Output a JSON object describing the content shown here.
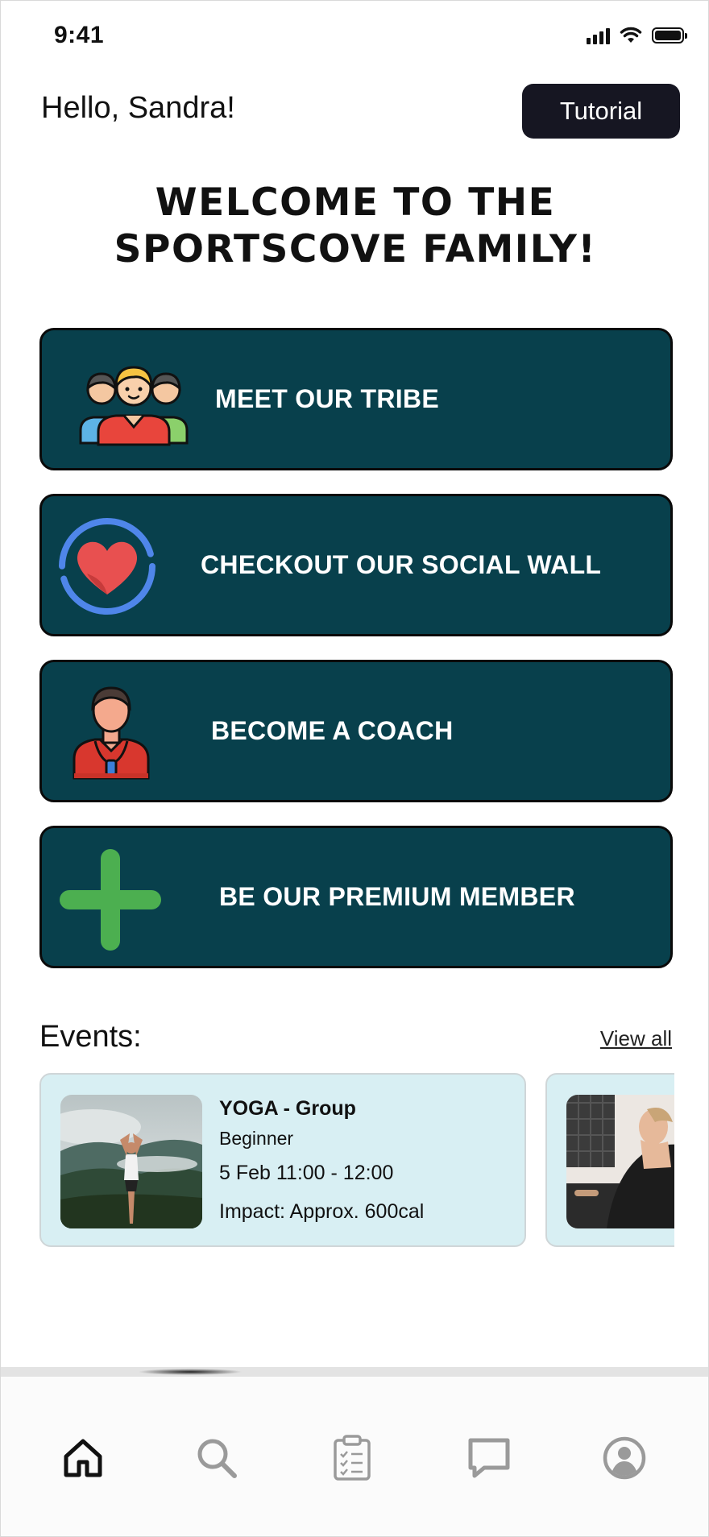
{
  "status": {
    "time": "9:41"
  },
  "header": {
    "greeting": "Hello, Sandra!",
    "tutorial_label": "Tutorial"
  },
  "welcome": {
    "line1": "WELCOME TO THE",
    "line2": "SPORTSCOVE FAMILY!"
  },
  "actions": [
    {
      "label": "MEET OUR TRIBE",
      "icon": "group-people-icon"
    },
    {
      "label": "CHECKOUT OUR SOCIAL WALL",
      "icon": "heart-ring-icon"
    },
    {
      "label": "BECOME A COACH",
      "icon": "coach-icon"
    },
    {
      "label": "BE OUR PREMIUM MEMBER",
      "icon": "plus-icon"
    }
  ],
  "events": {
    "title": "Events:",
    "view_all": "View all",
    "items": [
      {
        "title": "YOGA - Group",
        "level": "Beginner",
        "time": "5 Feb 11:00 - 12:00",
        "impact": "Impact: Approx. 600cal",
        "image": "yoga-mountain-photo"
      },
      {
        "image": "yoga-stretch-photo"
      }
    ]
  },
  "tabs": [
    {
      "name": "home",
      "icon": "home-icon",
      "active": true
    },
    {
      "name": "search",
      "icon": "search-icon",
      "active": false
    },
    {
      "name": "tasks",
      "icon": "clipboard-icon",
      "active": false
    },
    {
      "name": "chat",
      "icon": "chat-icon",
      "active": false
    },
    {
      "name": "profile",
      "icon": "profile-icon",
      "active": false
    }
  ],
  "colors": {
    "card_bg": "#08404c",
    "event_bg": "#d8eff3",
    "tutorial_bg": "#161622",
    "active_tab": "#111111",
    "inactive_tab": "#9a9a9a"
  }
}
